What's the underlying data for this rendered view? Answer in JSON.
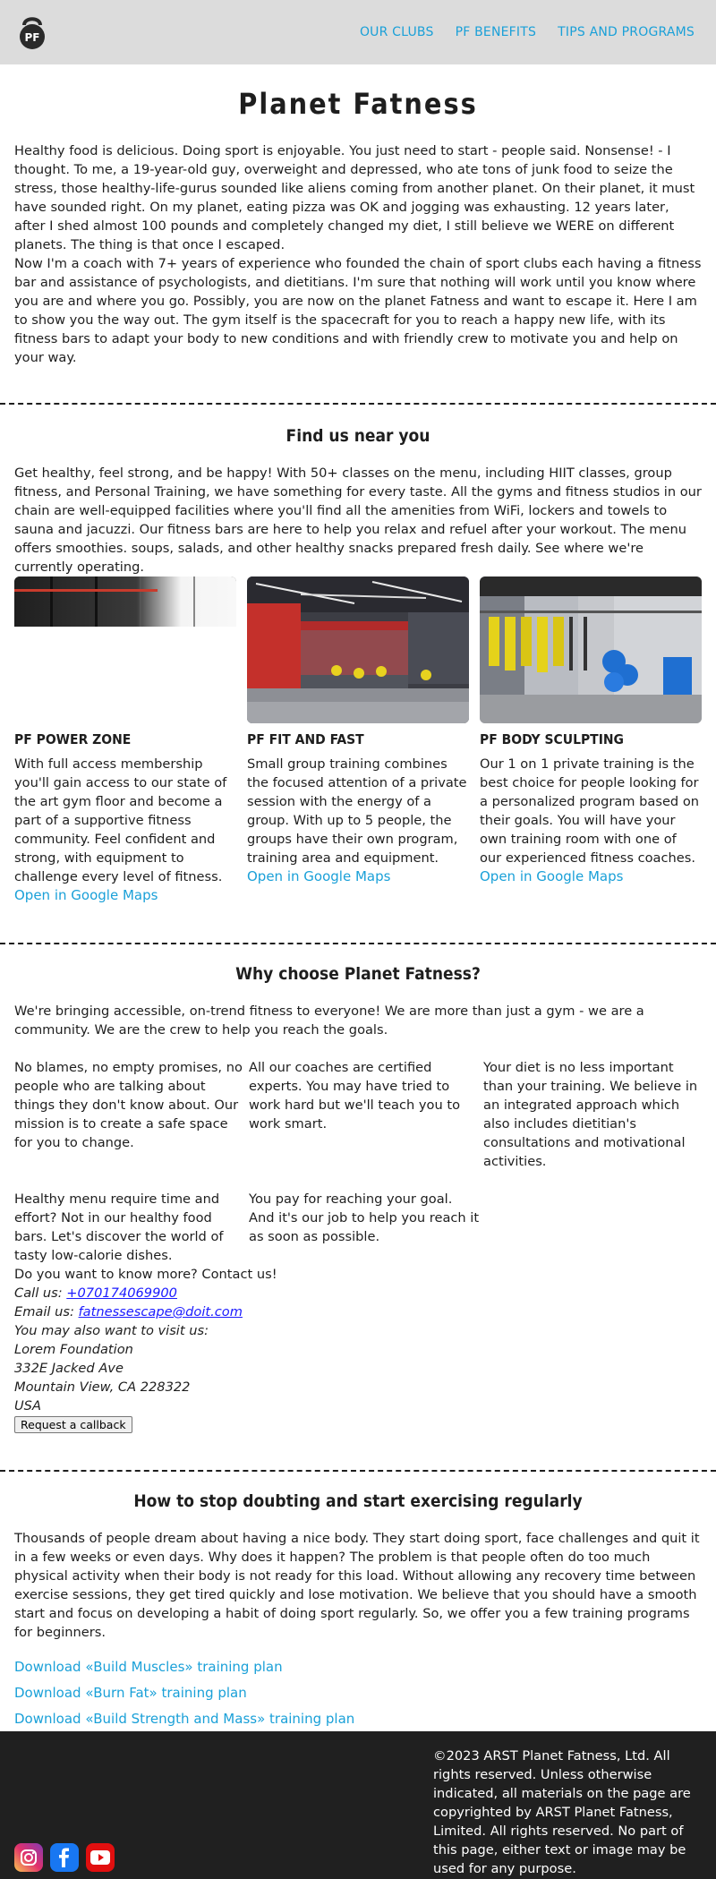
{
  "header": {
    "logo_text": "PF",
    "nav": [
      "OUR CLUBS",
      "PF BENEFITS",
      "TIPS AND PROGRAMS"
    ]
  },
  "intro": {
    "title": "Planet Fatness",
    "p1": "Healthy food is delicious. Doing sport is enjoyable. You just need to start - people said. Nonsense! - I thought. To me, a 19-year-old guy, overweight and depressed, who ate tons of junk food to seize the stress, those healthy-life-gurus sounded like aliens coming from another planet. On their planet, it must have sounded right. On my planet, eating pizza was OK and jogging was exhausting. 12 years later, after I shed almost 100 pounds and completely changed my diet, I still believe we WERE on different planets. The thing is that once I escaped.",
    "p2": "Now I'm a coach with 7+ years of experience who founded the chain of sport clubs each having a fitness bar and assistance of psychologists, and dietitians. I'm sure that nothing will work until you know where you are and where you go. Possibly, you are now on the planet Fatness and want to escape it. Here I am to show you the way out. The gym itself is the spacecraft for you to reach a happy new life, with its fitness bars to adapt your body to new conditions and with friendly crew to motivate you and help on your way."
  },
  "clubs_section": {
    "title": "Find us near you",
    "text": "Get healthy, feel strong, and be happy! With 50+ classes on the menu, including HIIT classes, group fitness, and Personal Training, we have something for every taste. All the gyms and fitness studios in our chain are well-equipped facilities where you'll find all the amenities from WiFi, lockers and towels to sauna and jacuzzi. Our fitness bars are here to help you relax and refuel after your workout. The menu offers smoothies. soups, salads, and other healthy snacks prepared fresh daily. See where we're currently operating.",
    "clubs": [
      {
        "name": "PF POWER ZONE",
        "text": "With full access membership you'll gain access to our state of the art gym floor and become a part of a supportive fitness community. Feel confident and strong, with equipment to challenge every level of fitness.",
        "link": "Open in Google Maps"
      },
      {
        "name": "PF FIT AND FAST",
        "text": "Small group training combines the focused attention of a private session with the energy of a group. With up to 5 people, the groups have their own program, training area and equipment.",
        "link": "Open in Google Maps"
      },
      {
        "name": "PF BODY SCULPTING",
        "text": "Our 1 on 1 private training is the best choice for people looking for a personalized program based on their goals. You will have your own training room with one of our experienced fitness coaches.",
        "link": "Open in Google Maps"
      }
    ]
  },
  "benefits": {
    "title": "Why choose Planet Fatness?",
    "intro": "We're bringing accessible, on-trend fitness to everyone! We are more than just a gym - we are a community. We are the crew to help you reach the goals.",
    "items": [
      "No blames, no empty promises, no people who are talking about things they don't know about. Our mission is to create a safe space for you to change.",
      "All our coaches are certified experts. You may have tried to work hard but we'll teach you to work smart.",
      "Your diet is no less important than your training. We believe in an integrated approach which also includes dietitian's consultations and motivational activities.",
      "Healthy menu require time and effort? Not in our healthy food bars. Let's discover the world of tasty low-calorie dishes.",
      "You pay for reaching your goal. And it's our job to help you reach it as soon as possible."
    ],
    "contact": {
      "intro": "Do you want to know more? Contact us!",
      "call_label": "Call us: ",
      "phone": "+070174069900",
      "email_label": "Email us: ",
      "email": "fatnessescape@doit.com",
      "visit": "You may also want to visit us:",
      "address": [
        "Lorem Foundation",
        "332E Jacked Ave",
        "Mountain View, CA 228322",
        "USA"
      ],
      "button": "Request a callback"
    }
  },
  "tips": {
    "title": "How to stop doubting and start exercising regularly",
    "text": "Thousands of people dream about having a nice body. They start doing sport, face challenges and quit it in a few weeks or even days. Why does it happen? The problem is that people often do too much physical activity when their body is not ready for this load. Without allowing any recovery time between exercise sessions, they get tired quickly and lose motivation. We believe that you should have a smooth start and focus on developing a habit of doing sport regularly. So, we offer you a few training programs for beginners.",
    "downloads": [
      "Download «Build Muscles» training plan",
      "Download «Burn Fat» training plan",
      "Download «Build Strength and Mass» training plan"
    ]
  },
  "footer": {
    "copyright": "©2023 ARST Planet Fatness, Ltd. All rights reserved. Unless otherwise indicated, all materials on the page are copyrighted by ARST Planet Fatness, Limited. All rights reserved. No part of this page, either text or image may be used for any purpose.",
    "socials": [
      "instagram-icon",
      "facebook-icon",
      "youtube-icon"
    ]
  },
  "colors": {
    "accent": "#1aa0d8",
    "header_bg": "#dcdcdc",
    "footer_bg": "#202020"
  }
}
